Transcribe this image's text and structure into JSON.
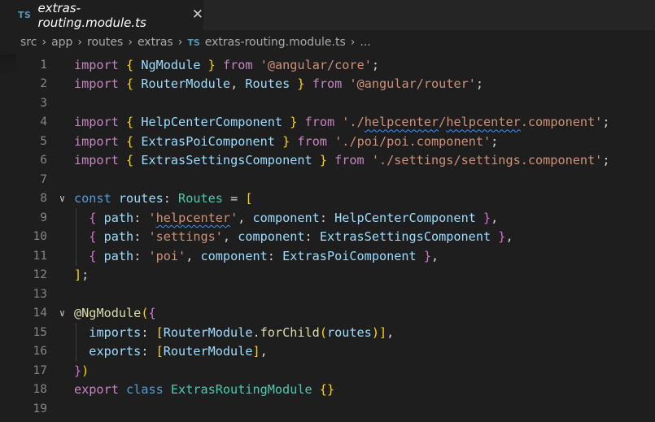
{
  "tab": {
    "badge": "TS",
    "title": "extras-routing.module.ts",
    "close": "✕"
  },
  "breadcrumb": {
    "items": [
      "src",
      "app",
      "routes",
      "extras"
    ],
    "file_badge": "TS",
    "file": "extras-routing.module.ts",
    "more": "..."
  },
  "lines": [
    {
      "n": "1",
      "tokens": [
        [
          "import",
          "kw-import"
        ],
        [
          " ",
          ""
        ],
        [
          "{",
          "brace"
        ],
        [
          " ",
          ""
        ],
        [
          "NgModule",
          "var"
        ],
        [
          " ",
          ""
        ],
        [
          "}",
          "brace"
        ],
        [
          " ",
          ""
        ],
        [
          "from",
          "kw-import"
        ],
        [
          " ",
          ""
        ],
        [
          "'@angular/core'",
          "str"
        ],
        [
          ";",
          "punc"
        ]
      ]
    },
    {
      "n": "2",
      "tokens": [
        [
          "import",
          "kw-import"
        ],
        [
          " ",
          ""
        ],
        [
          "{",
          "brace"
        ],
        [
          " ",
          ""
        ],
        [
          "RouterModule",
          "var"
        ],
        [
          ", ",
          "punc"
        ],
        [
          "Routes",
          "var"
        ],
        [
          " ",
          ""
        ],
        [
          "}",
          "brace"
        ],
        [
          " ",
          ""
        ],
        [
          "from",
          "kw-import"
        ],
        [
          " ",
          ""
        ],
        [
          "'@angular/router'",
          "str"
        ],
        [
          ";",
          "punc"
        ]
      ]
    },
    {
      "n": "3",
      "tokens": []
    },
    {
      "n": "4",
      "tokens": [
        [
          "import",
          "kw-import"
        ],
        [
          " ",
          ""
        ],
        [
          "{",
          "brace"
        ],
        [
          " ",
          ""
        ],
        [
          "HelpCenterComponent",
          "var"
        ],
        [
          " ",
          ""
        ],
        [
          "}",
          "brace"
        ],
        [
          " ",
          ""
        ],
        [
          "from",
          "kw-import"
        ],
        [
          " ",
          ""
        ],
        [
          "'./",
          "str"
        ],
        [
          "helpcenter",
          "str-sq"
        ],
        [
          "/",
          "str"
        ],
        [
          "helpcenter",
          "str-sq"
        ],
        [
          ".component'",
          "str"
        ],
        [
          ";",
          "punc"
        ]
      ]
    },
    {
      "n": "5",
      "tokens": [
        [
          "import",
          "kw-import"
        ],
        [
          " ",
          ""
        ],
        [
          "{",
          "brace"
        ],
        [
          " ",
          ""
        ],
        [
          "ExtrasPoiComponent",
          "var"
        ],
        [
          " ",
          ""
        ],
        [
          "}",
          "brace"
        ],
        [
          " ",
          ""
        ],
        [
          "from",
          "kw-import"
        ],
        [
          " ",
          ""
        ],
        [
          "'./poi/poi.component'",
          "str"
        ],
        [
          ";",
          "punc"
        ]
      ]
    },
    {
      "n": "6",
      "tokens": [
        [
          "import",
          "kw-import"
        ],
        [
          " ",
          ""
        ],
        [
          "{",
          "brace"
        ],
        [
          " ",
          ""
        ],
        [
          "ExtrasSettingsComponent",
          "var"
        ],
        [
          " ",
          ""
        ],
        [
          "}",
          "brace"
        ],
        [
          " ",
          ""
        ],
        [
          "from",
          "kw-import"
        ],
        [
          " ",
          ""
        ],
        [
          "'./settings/settings.component'",
          "str"
        ],
        [
          ";",
          "punc"
        ]
      ]
    },
    {
      "n": "7",
      "tokens": []
    },
    {
      "n": "8",
      "fold": "∨",
      "tokens": [
        [
          "const",
          "kw"
        ],
        [
          " ",
          ""
        ],
        [
          "routes",
          "var"
        ],
        [
          ": ",
          "punc"
        ],
        [
          "Routes",
          "type"
        ],
        [
          " = ",
          "punc"
        ],
        [
          "[",
          "brace"
        ]
      ]
    },
    {
      "n": "9",
      "tokens": [
        [
          "  ",
          ""
        ],
        [
          "{",
          "brace2"
        ],
        [
          " ",
          ""
        ],
        [
          "path",
          "var"
        ],
        [
          ": ",
          "punc"
        ],
        [
          "'",
          "str"
        ],
        [
          "helpcenter",
          "str-sq"
        ],
        [
          "'",
          "str"
        ],
        [
          ", ",
          "punc"
        ],
        [
          "component",
          "var"
        ],
        [
          ": ",
          "punc"
        ],
        [
          "HelpCenterComponent",
          "var"
        ],
        [
          " ",
          ""
        ],
        [
          "}",
          "brace2"
        ],
        [
          ",",
          "punc"
        ]
      ]
    },
    {
      "n": "10",
      "tokens": [
        [
          "  ",
          ""
        ],
        [
          "{",
          "brace2"
        ],
        [
          " ",
          ""
        ],
        [
          "path",
          "var"
        ],
        [
          ": ",
          "punc"
        ],
        [
          "'settings'",
          "str"
        ],
        [
          ", ",
          "punc"
        ],
        [
          "component",
          "var"
        ],
        [
          ": ",
          "punc"
        ],
        [
          "ExtrasSettingsComponent",
          "var"
        ],
        [
          " ",
          ""
        ],
        [
          "}",
          "brace2"
        ],
        [
          ",",
          "punc"
        ]
      ]
    },
    {
      "n": "11",
      "tokens": [
        [
          "  ",
          ""
        ],
        [
          "{",
          "brace2"
        ],
        [
          " ",
          ""
        ],
        [
          "path",
          "var"
        ],
        [
          ": ",
          "punc"
        ],
        [
          "'poi'",
          "str"
        ],
        [
          ", ",
          "punc"
        ],
        [
          "component",
          "var"
        ],
        [
          ": ",
          "punc"
        ],
        [
          "ExtrasPoiComponent",
          "var"
        ],
        [
          " ",
          ""
        ],
        [
          "}",
          "brace2"
        ],
        [
          ",",
          "punc"
        ]
      ]
    },
    {
      "n": "12",
      "tokens": [
        [
          "]",
          "brace"
        ],
        [
          ";",
          "punc"
        ]
      ]
    },
    {
      "n": "13",
      "tokens": []
    },
    {
      "n": "14",
      "fold": "∨",
      "tokens": [
        [
          "@",
          "fn"
        ],
        [
          "NgModule",
          "fn"
        ],
        [
          "(",
          "brace"
        ],
        [
          "{",
          "brace2"
        ]
      ]
    },
    {
      "n": "15",
      "tokens": [
        [
          "  ",
          ""
        ],
        [
          "imports",
          "var"
        ],
        [
          ": ",
          "punc"
        ],
        [
          "[",
          "brace"
        ],
        [
          "RouterModule",
          "var"
        ],
        [
          ".",
          "punc"
        ],
        [
          "forChild",
          "fn"
        ],
        [
          "(",
          "brace"
        ],
        [
          "routes",
          "var"
        ],
        [
          ")",
          "brace"
        ],
        [
          "]",
          "brace"
        ],
        [
          ",",
          "punc"
        ]
      ]
    },
    {
      "n": "16",
      "tokens": [
        [
          "  ",
          ""
        ],
        [
          "exports",
          "var"
        ],
        [
          ": ",
          "punc"
        ],
        [
          "[",
          "brace"
        ],
        [
          "RouterModule",
          "var"
        ],
        [
          "]",
          "brace"
        ],
        [
          ",",
          "punc"
        ]
      ]
    },
    {
      "n": "17",
      "tokens": [
        [
          "}",
          "brace2"
        ],
        [
          ")",
          "brace"
        ]
      ]
    },
    {
      "n": "18",
      "tokens": [
        [
          "export",
          "kw-import"
        ],
        [
          " ",
          ""
        ],
        [
          "class",
          "kw"
        ],
        [
          " ",
          ""
        ],
        [
          "ExtrasRoutingModule",
          "type"
        ],
        [
          " ",
          ""
        ],
        [
          "{}",
          "brace"
        ]
      ]
    },
    {
      "n": "19",
      "tokens": []
    }
  ],
  "colors": {
    "background": "#1e1e1e",
    "tabbar": "#252526",
    "keyword": "#569cd6",
    "control": "#c586c0",
    "string": "#ce9178",
    "variable": "#9cdcfe",
    "type": "#4ec9b0",
    "function": "#dcdcaa",
    "bracket1": "#ffd700",
    "bracket2": "#da70d6"
  }
}
